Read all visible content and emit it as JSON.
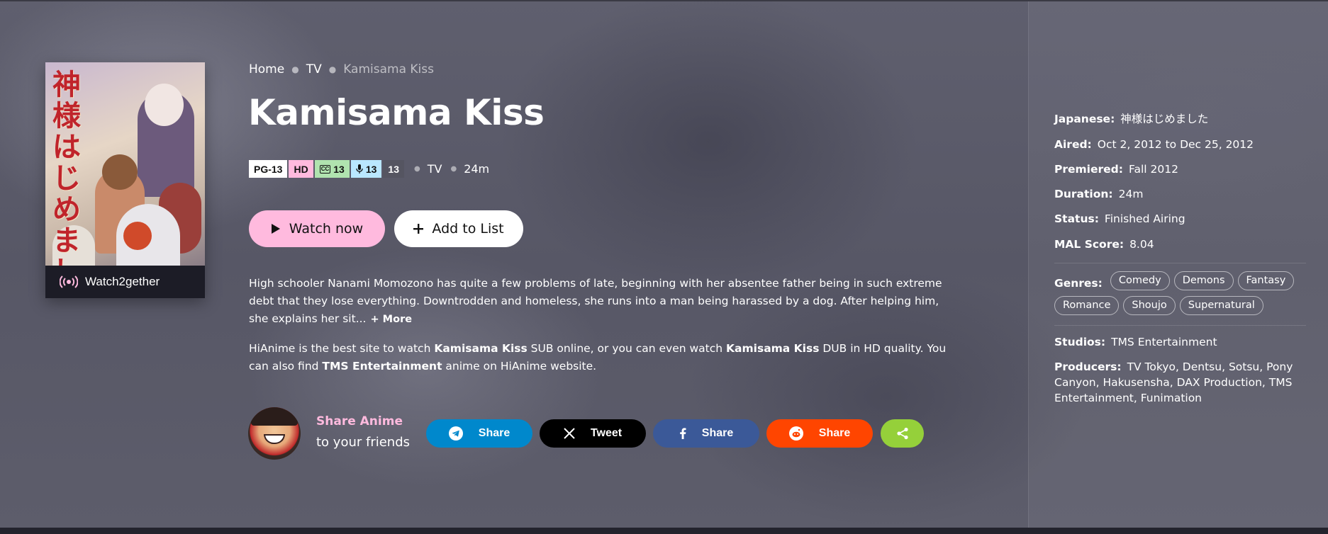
{
  "breadcrumb": {
    "home": "Home",
    "type": "TV",
    "current": "Kamisama Kiss"
  },
  "anime": {
    "title": "Kamisama Kiss",
    "poster_title": "神様はじめました",
    "tags": {
      "rating": "PG-13",
      "quality": "HD",
      "sub": "13",
      "dub": "13",
      "episodes": "13"
    },
    "type": "TV",
    "duration": "24m",
    "description": "High schooler Nanami Momozono has quite a few problems of late, beginning with her absentee father being in such extreme debt that they lose everything. Downtrodden and homeless, she runs into a man being harassed by a dog. After helping him, she explains her sit...",
    "more_label": "+ More",
    "promo": {
      "p1": "HiAnime is the best site to watch ",
      "b1": "Kamisama Kiss",
      "p2": " SUB online, or you can even watch ",
      "b2": "Kamisama Kiss",
      "p3": " DUB in HD quality. You can also find ",
      "b3": "TMS Entertainment",
      "p4": " anime on HiAnime website."
    }
  },
  "actions": {
    "watch": "Watch now",
    "add": "Add to List",
    "watch2gether": "Watch2gether"
  },
  "share": {
    "title": "Share Anime",
    "subtitle": "to your friends",
    "telegram": "Share",
    "twitter": "Tweet",
    "facebook": "Share",
    "reddit": "Share"
  },
  "info": {
    "japanese_k": "Japanese:",
    "japanese_v": "神様はじめました",
    "aired_k": "Aired:",
    "aired_v": "Oct 2, 2012 to Dec 25, 2012",
    "premiered_k": "Premiered:",
    "premiered_v": "Fall 2012",
    "duration_k": "Duration:",
    "duration_v": "24m",
    "status_k": "Status:",
    "status_v": "Finished Airing",
    "mal_k": "MAL Score:",
    "mal_v": "8.04",
    "genres_k": "Genres:",
    "genres": [
      "Comedy",
      "Demons",
      "Fantasy",
      "Romance",
      "Shoujo",
      "Supernatural"
    ],
    "studios_k": "Studios:",
    "studios_v": "TMS Entertainment",
    "producers_k": "Producers:",
    "producers_v": "TV Tokyo, Dentsu, Sotsu, Pony Canyon, Hakusensha, DAX Production, TMS Entertainment, Funimation"
  },
  "colors": {
    "accent": "#ffbade",
    "sub_tag": "#b0e3af",
    "dub_tag": "#b9e7ff",
    "telegram": "#0088cc",
    "twitter": "#000000",
    "facebook": "#3b5998",
    "reddit": "#ff4500",
    "more_share": "#95d03a"
  },
  "icons": {
    "play": "play-icon",
    "plus": "plus-icon",
    "broadcast": "broadcast-icon",
    "cc": "closed-caption-icon",
    "mic": "microphone-icon",
    "telegram": "telegram-icon",
    "x": "x-icon",
    "facebook": "facebook-icon",
    "reddit": "reddit-icon",
    "share": "share-icon"
  }
}
